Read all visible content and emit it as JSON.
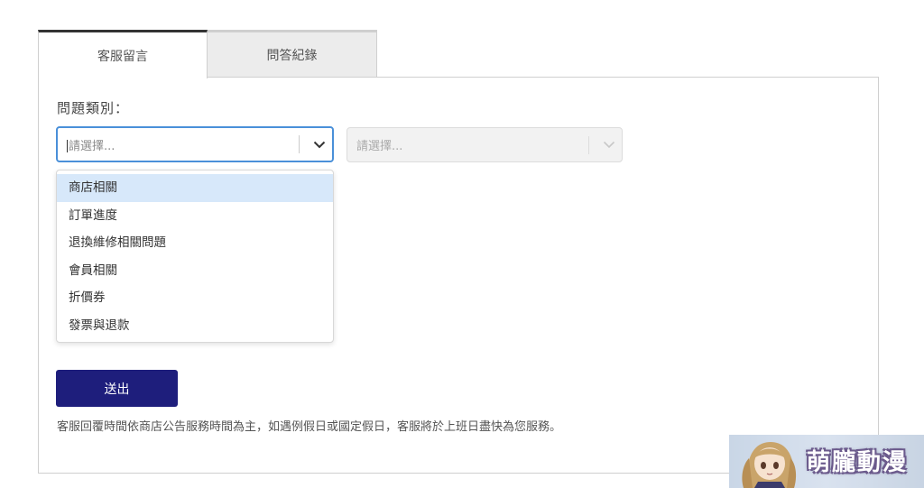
{
  "tabs": [
    {
      "label": "客服留言",
      "active": true
    },
    {
      "label": "問答紀錄",
      "active": false
    }
  ],
  "form": {
    "category_label": "問題類別：",
    "select_primary": {
      "placeholder": "請選擇..."
    },
    "select_secondary": {
      "placeholder": "請選擇..."
    },
    "dropdown_options": [
      "商店相關",
      "訂單進度",
      "退換維修相關問題",
      "會員相關",
      "折價券",
      "發票與退款"
    ],
    "submit_label": "送出",
    "notice": "客服回覆時間依商店公告服務時間為主，如遇例假日或國定假日，客服將於上班日盡快為您服務。"
  },
  "watermark": {
    "text": "萌朧動漫"
  },
  "colors": {
    "accent_focus": "#4a90d9",
    "submit_bg": "#1e1e7c",
    "option_highlight": "#d7e8fa"
  }
}
